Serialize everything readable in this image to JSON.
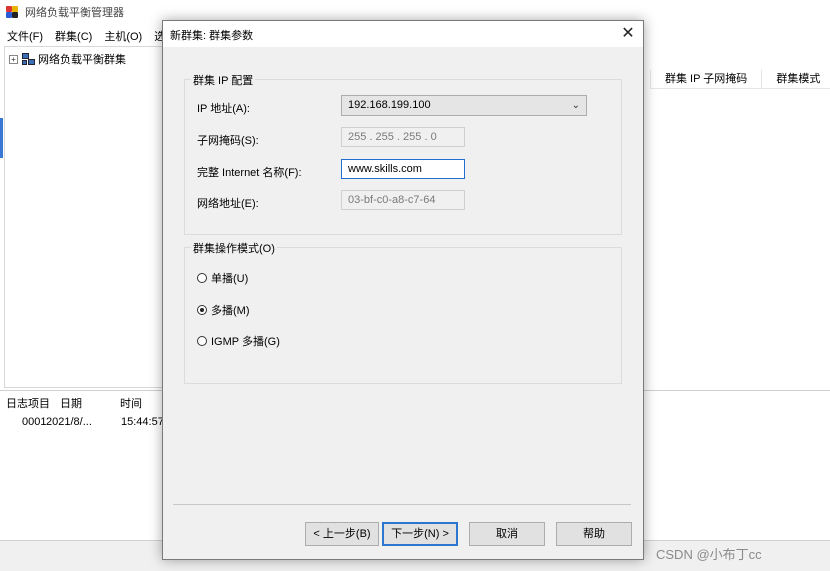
{
  "app": {
    "title": "网络负载平衡管理器",
    "menu": [
      "文件(F)",
      "群集(C)",
      "主机(O)",
      "选"
    ],
    "tree_root": "网络负载平衡群集",
    "right_columns": [
      "群集 IP 子网掩码",
      "群集模式"
    ],
    "log": {
      "headers": [
        "日志项目",
        "日期",
        "时间"
      ],
      "row": [
        "0001",
        "2021/8/...",
        "15:44:57"
      ]
    }
  },
  "dialog": {
    "title": "新群集: 群集参数",
    "close_glyph": "✕",
    "ip_group": {
      "title": "群集 IP 配置",
      "ip_label": "IP 地址(A):",
      "ip_value": "192.168.199.100",
      "subnet_label": "子网掩码(S):",
      "subnet_value": "255 . 255 . 255 .  0",
      "fqdn_label": "完整 Internet 名称(F):",
      "fqdn_value": "www.skills.com",
      "netaddr_label": "网络地址(E):",
      "netaddr_value": "03-bf-c0-a8-c7-64"
    },
    "mode_group": {
      "title": "群集操作模式(O)",
      "options": [
        {
          "label": "单播(U)",
          "selected": false
        },
        {
          "label": "多播(M)",
          "selected": true
        },
        {
          "label": "IGMP 多播(G)",
          "selected": false
        }
      ]
    },
    "buttons": {
      "back": "< 上一步(B)",
      "next": "下一步(N) >",
      "cancel": "取消",
      "help": "帮助"
    }
  },
  "watermark": "CSDN @小布丁cc"
}
